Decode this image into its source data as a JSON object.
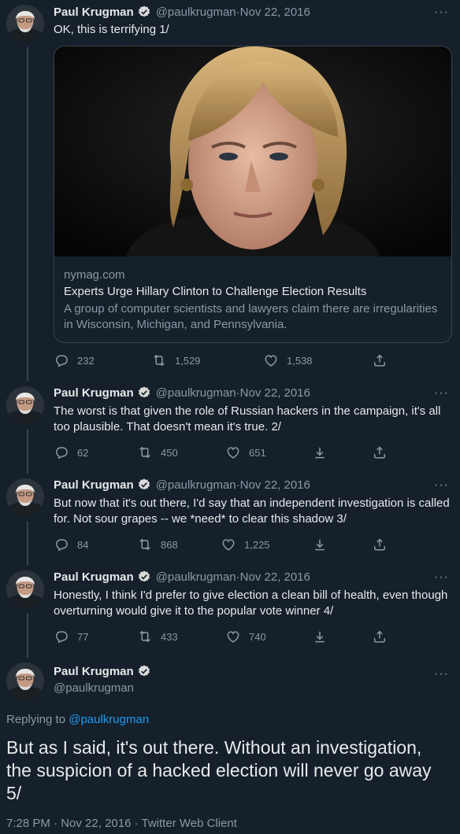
{
  "author": {
    "name": "Paul Krugman",
    "handle": "@paulkrugman"
  },
  "tweets": [
    {
      "date": "Nov 22, 2016",
      "text": "OK, this is terrifying 1/",
      "card": {
        "domain": "nymag.com",
        "title": "Experts Urge Hillary Clinton to Challenge Election Results",
        "description": "A group of computer scientists and lawyers claim there are irregularities in Wisconsin, Michigan, and Pennsylvania."
      },
      "replies": "232",
      "retweets": "1,529",
      "likes": "1,538"
    },
    {
      "date": "Nov 22, 2016",
      "text": "The worst is that given the role of Russian hackers in the campaign, it's all too plausible. That doesn't mean it's true. 2/",
      "replies": "62",
      "retweets": "450",
      "likes": "651"
    },
    {
      "date": "Nov 22, 2016",
      "text": "But now that it's out there, I'd say that an independent investigation is called for. Not sour grapes -- we *need* to clear this shadow 3/",
      "replies": "84",
      "retweets": "868",
      "likes": "1,225"
    },
    {
      "date": "Nov 22, 2016",
      "text": "Honestly, I think I'd prefer to give election a clean bill of health, even though overturning would give it to the popular vote winner 4/",
      "replies": "77",
      "retweets": "433",
      "likes": "740"
    }
  ],
  "main_tweet": {
    "replying_prefix": "Replying to ",
    "replying_handle": "@paulkrugman",
    "text": "But as I said, it's out there. Without an investigation, the suspicion of a hacked election will never go away 5/",
    "time": "7:28 PM",
    "date": "Nov 22, 2016",
    "source": "Twitter Web Client"
  },
  "header_separator": " · ",
  "more_glyph": "···",
  "icons": {
    "reply": "reply-icon",
    "retweet": "retweet-icon",
    "like": "like-icon",
    "share": "share-icon",
    "download": "download-icon",
    "verified": "verified-badge-icon"
  },
  "colors": {
    "background": "#15202b",
    "text": "#e7e9ea",
    "muted": "#8b98a5",
    "link": "#1d9bf0",
    "border": "#38444d"
  }
}
